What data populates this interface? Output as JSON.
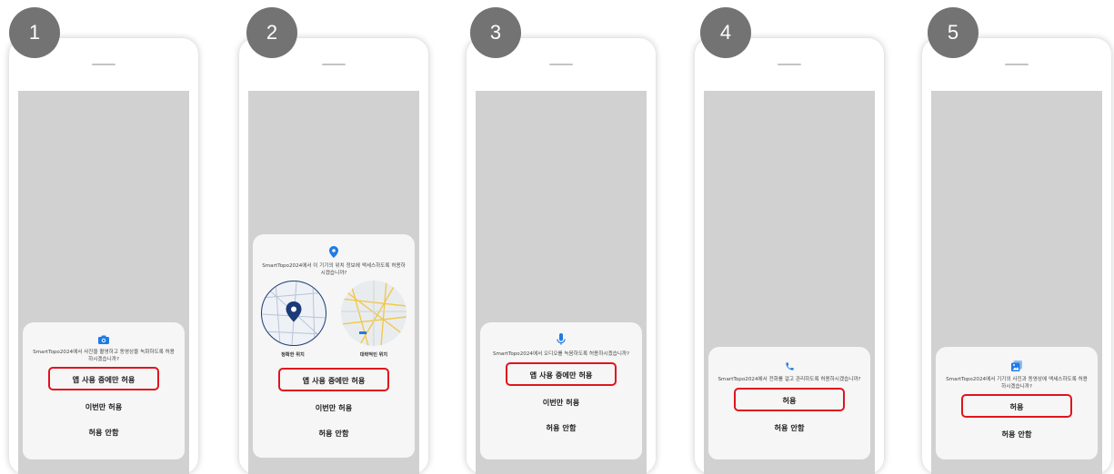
{
  "steps": [
    {
      "number": "1",
      "icon": "camera-icon",
      "message": "SmartTopo2024에서 사진을 촬영하고 동영상을 녹화하도록 허용하시겠습니까?",
      "buttons": [
        {
          "label": "앱 사용 중에만 허용",
          "highlighted": true
        },
        {
          "label": "이번만 허용",
          "highlighted": false
        },
        {
          "label": "허용 안함",
          "highlighted": false
        }
      ]
    },
    {
      "number": "2",
      "icon": "location-pin-icon",
      "message": "SmartTopo2024에서 이 기기의 위치 정보에 액세스하도록 허용하시겠습니까?",
      "map_labels": [
        "정확한 위치",
        "대략적인 위치"
      ],
      "buttons": [
        {
          "label": "앱 사용 중에만 허용",
          "highlighted": true
        },
        {
          "label": "이번만 허용",
          "highlighted": false
        },
        {
          "label": "허용 안함",
          "highlighted": false
        }
      ]
    },
    {
      "number": "3",
      "icon": "microphone-icon",
      "message": "SmartTopo2024에서 오디오를 녹음하도록 허용하시겠습니까?",
      "buttons": [
        {
          "label": "앱 사용 중에만 허용",
          "highlighted": true
        },
        {
          "label": "이번만 허용",
          "highlighted": false
        },
        {
          "label": "허용 안함",
          "highlighted": false
        }
      ]
    },
    {
      "number": "4",
      "icon": "phone-icon",
      "message": "SmartTopo2024에서 전화를 걸고 관리하도록 허용하시겠습니까?",
      "buttons": [
        {
          "label": "허용",
          "highlighted": true
        },
        {
          "label": "허용 안함",
          "highlighted": false
        }
      ]
    },
    {
      "number": "5",
      "icon": "photo-icon",
      "message": "SmartTopo2024에서 기기의 사진과 동영상에 액세스하도록 허용하시겠습니까?",
      "buttons": [
        {
          "label": "허용",
          "highlighted": true
        },
        {
          "label": "허용 안함",
          "highlighted": false
        }
      ]
    }
  ],
  "colors": {
    "icon_blue": "#1e7be6",
    "highlight_red": "#e0141e",
    "badge_gray": "#737373",
    "screen_gray": "#d1d1d1"
  }
}
